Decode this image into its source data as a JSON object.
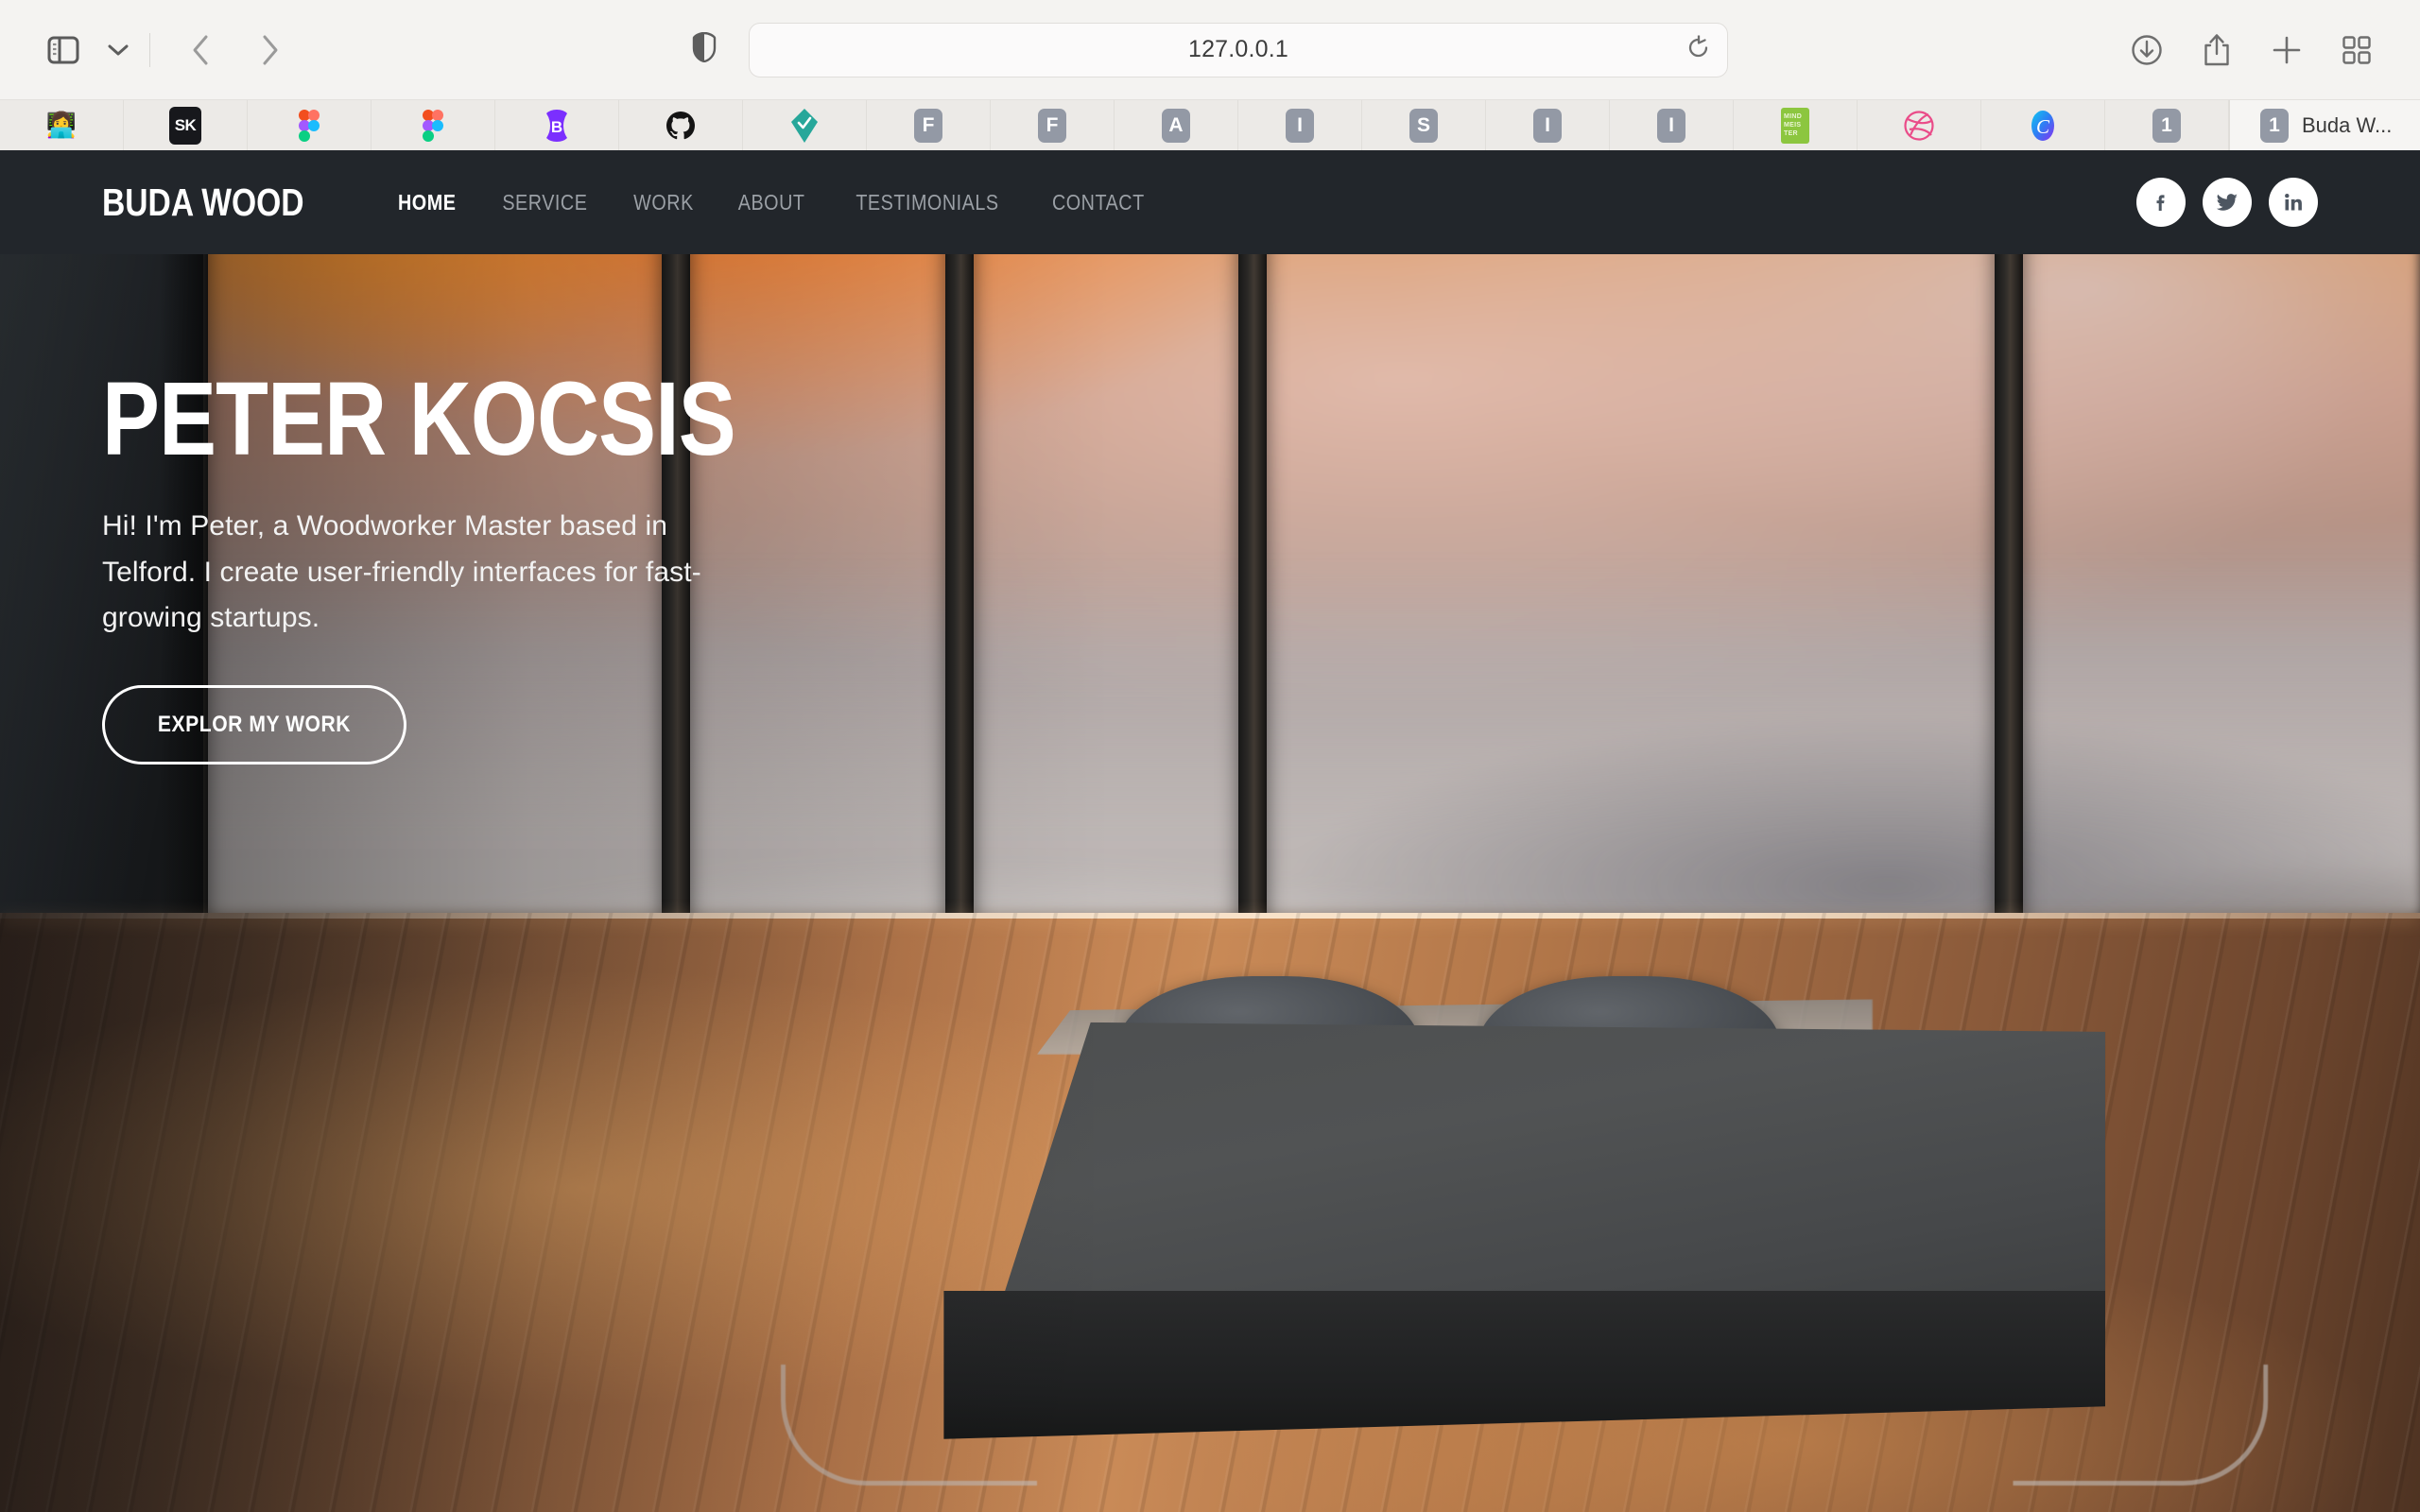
{
  "browser": {
    "url": "127.0.0.1",
    "toolbar_icons": {
      "sidebar": "sidebar-icon",
      "chevron": "chevron-down-icon",
      "back": "back-arrow-icon",
      "forward": "forward-arrow-icon",
      "shield": "privacy-shield-icon",
      "reload": "reload-icon",
      "downloads": "downloads-icon",
      "share": "share-icon",
      "new_tab": "plus-icon",
      "tab_overview": "tab-overview-icon"
    },
    "bookmarks": [
      {
        "name": "bookmark-avatar",
        "type": "emoji",
        "glyph": "👩‍💻"
      },
      {
        "name": "bookmark-sk",
        "type": "sk",
        "label": "SK"
      },
      {
        "name": "bookmark-figma-1",
        "type": "figma"
      },
      {
        "name": "bookmark-figma-2",
        "type": "figma"
      },
      {
        "name": "bookmark-bootstrap",
        "type": "bootstrap",
        "label": "B"
      },
      {
        "name": "bookmark-github",
        "type": "github"
      },
      {
        "name": "bookmark-check",
        "type": "check-diamond"
      },
      {
        "name": "bookmark-f-1",
        "type": "letter",
        "label": "F"
      },
      {
        "name": "bookmark-f-2",
        "type": "letter",
        "label": "F"
      },
      {
        "name": "bookmark-a",
        "type": "letter",
        "label": "A"
      },
      {
        "name": "bookmark-i-1",
        "type": "letter",
        "label": "I"
      },
      {
        "name": "bookmark-s",
        "type": "letter",
        "label": "S"
      },
      {
        "name": "bookmark-i-2",
        "type": "letter",
        "label": "I"
      },
      {
        "name": "bookmark-i-3",
        "type": "letter",
        "label": "I"
      },
      {
        "name": "bookmark-mindmeister",
        "type": "mind",
        "label": "MIND MEIS TER"
      },
      {
        "name": "bookmark-dribbble",
        "type": "dribbble"
      },
      {
        "name": "bookmark-c",
        "type": "gradient-c",
        "label": "C"
      },
      {
        "name": "bookmark-one",
        "type": "letter",
        "label": "1"
      }
    ],
    "active_tab": {
      "badge": "1",
      "title": "Buda W..."
    }
  },
  "site": {
    "logo": "BUDA WOOD",
    "nav": [
      {
        "label": "HOME",
        "active": true
      },
      {
        "label": "SERVICE",
        "active": false
      },
      {
        "label": "WORK",
        "active": false
      },
      {
        "label": "ABOUT",
        "active": false
      },
      {
        "label": "TESTIMONIALS",
        "active": false
      },
      {
        "label": "CONTACT",
        "active": false
      }
    ],
    "socials": [
      {
        "name": "facebook-icon",
        "label": "f"
      },
      {
        "name": "twitter-icon",
        "label": "t"
      },
      {
        "name": "linkedin-icon",
        "label": "in"
      }
    ],
    "hero": {
      "title": "PETER KOCSIS",
      "subtitle": "Hi! I'm Peter, a Woodworker Master based in Telford. I create user-friendly interfaces for fast-growing startups.",
      "cta": "EXPLOR MY WORK"
    },
    "colors": {
      "header_bg": "#22262b",
      "nav_active": "#ffffff",
      "nav_muted": "#9ba0a6",
      "accent_white": "#ffffff"
    }
  }
}
